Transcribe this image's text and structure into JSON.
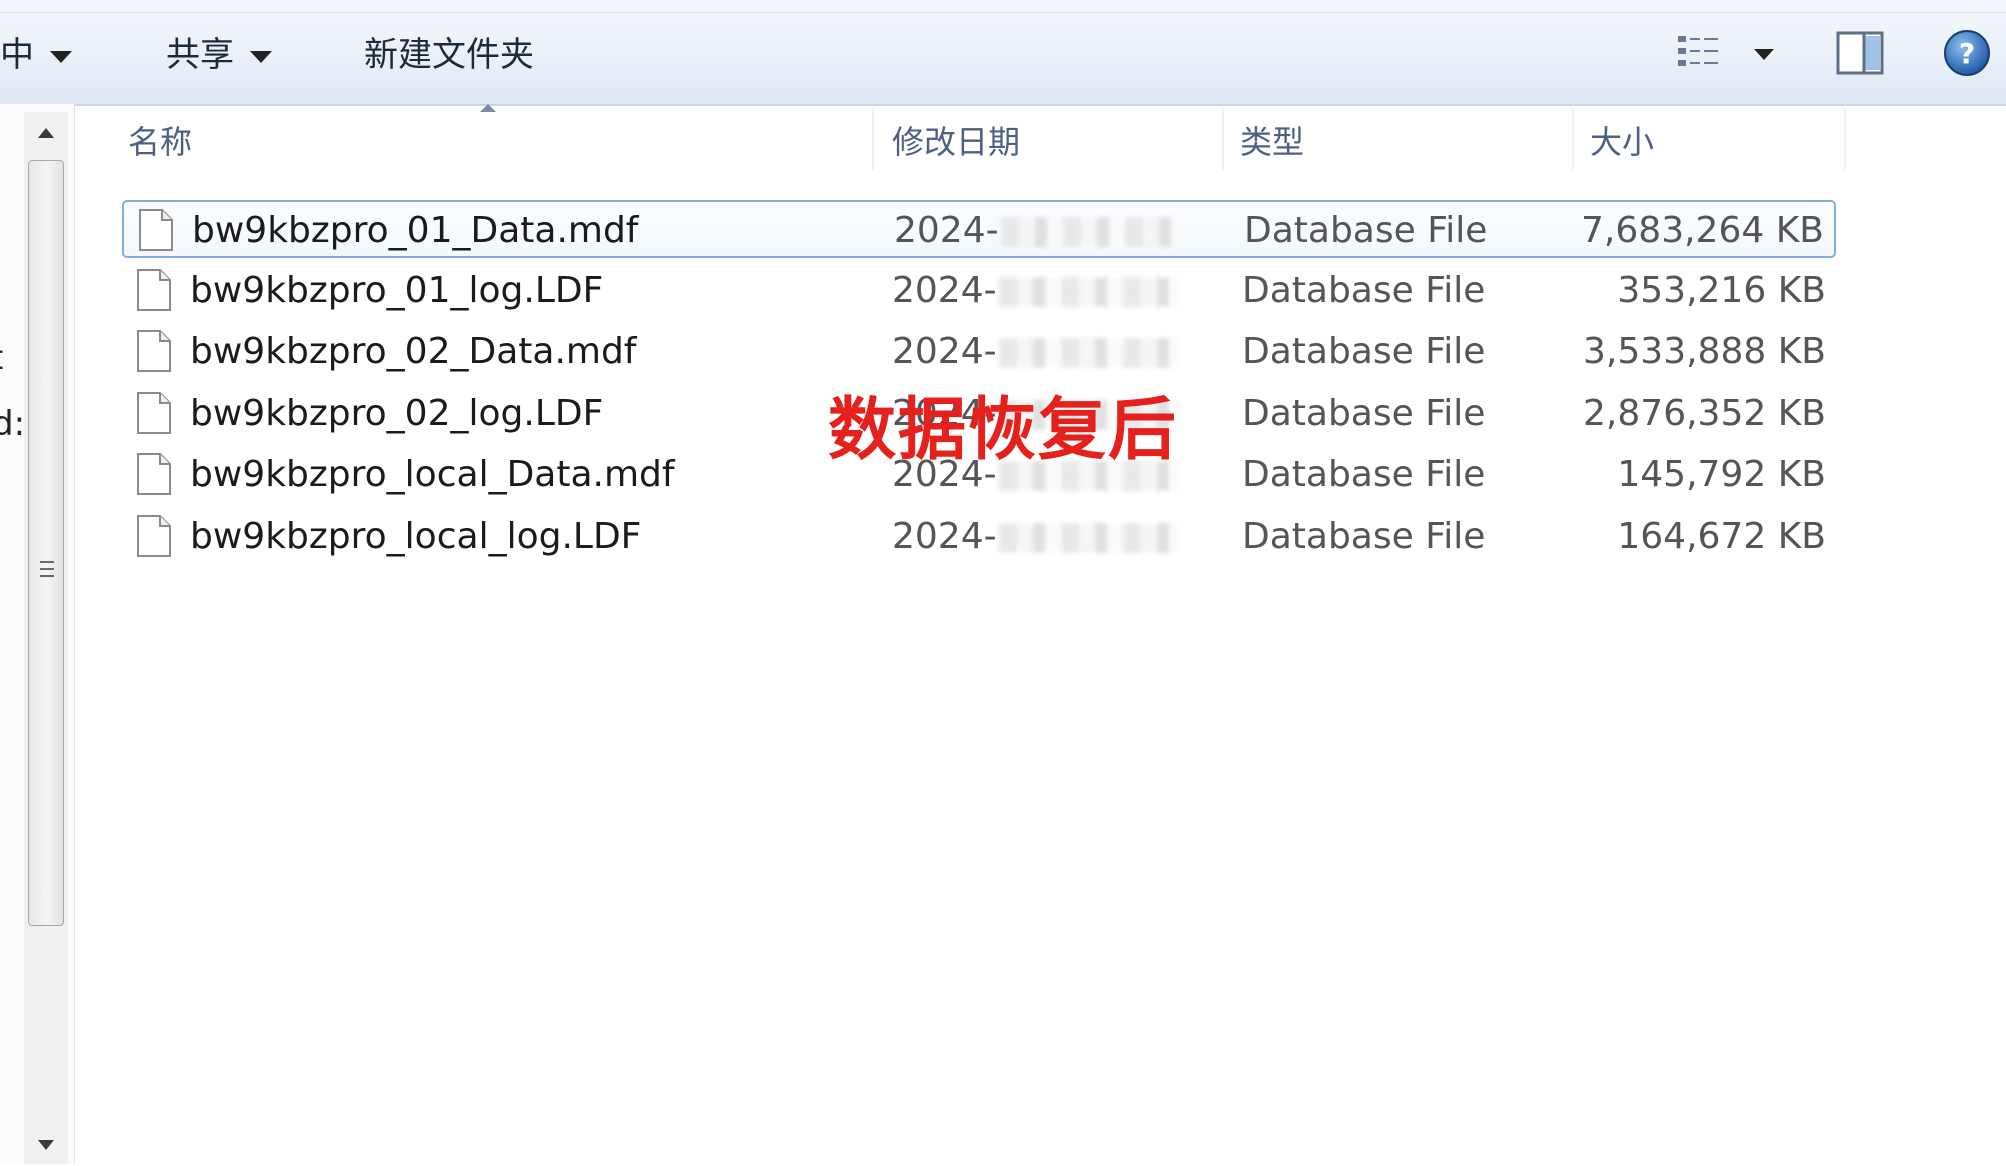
{
  "toolbar": {
    "include_label": "中",
    "share_label": "共享",
    "new_folder_label": "新建文件夹"
  },
  "columns": {
    "name": "名称",
    "modified": "修改日期",
    "type": "类型",
    "size": "大小"
  },
  "files": [
    {
      "name": "bw9kbzpro_01_Data.mdf",
      "date": "2024-",
      "type": "Database File",
      "size": "7,683,264 KB",
      "selected": true
    },
    {
      "name": "bw9kbzpro_01_log.LDF",
      "date": "2024-",
      "type": "Database File",
      "size": "353,216 KB",
      "selected": false
    },
    {
      "name": "bw9kbzpro_02_Data.mdf",
      "date": "2024-",
      "type": "Database File",
      "size": "3,533,888 KB",
      "selected": false
    },
    {
      "name": "bw9kbzpro_02_log.LDF",
      "date": "2024-",
      "type": "Database File",
      "size": "2,876,352 KB",
      "selected": false
    },
    {
      "name": "bw9kbzpro_local_Data.mdf",
      "date": "2024-",
      "type": "Database File",
      "size": "145,792 KB",
      "selected": false
    },
    {
      "name": "bw9kbzpro_local_log.LDF",
      "date": "2024-",
      "type": "Database File",
      "size": "164,672 KB",
      "selected": false
    }
  ],
  "overlay": {
    "text": "数据恢复后",
    "color": "#e5211d"
  },
  "left_pane_cut_text": [
    "t",
    "d:"
  ],
  "icons": [
    "file-icon",
    "view-options-icon",
    "preview-pane-icon",
    "help-icon",
    "scroll-up-icon",
    "scroll-down-icon"
  ]
}
